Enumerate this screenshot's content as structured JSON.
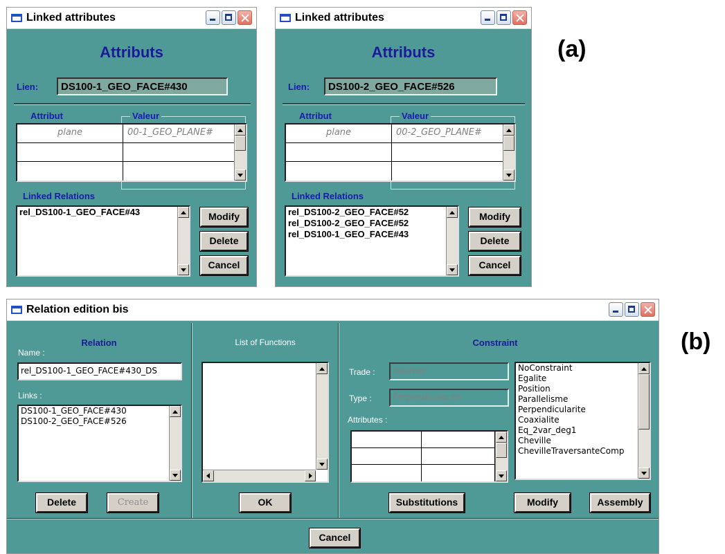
{
  "labels": {
    "a": "(a)",
    "b": "(b)"
  },
  "winA1": {
    "title": "Linked attributes",
    "heading": "Attributs",
    "lien_label": "Lien:",
    "lien_value": "DS100-1_GEO_FACE#430",
    "col_attribut": "Attribut",
    "col_valeur": "Valeur",
    "row_attr": "plane",
    "row_val": "00-1_GEO_PLANE#",
    "linked_label": "Linked Relations",
    "relations": [
      "rel_DS100-1_GEO_FACE#43"
    ],
    "btn_modify": "Modify",
    "btn_delete": "Delete",
    "btn_cancel": "Cancel"
  },
  "winA2": {
    "title": "Linked attributes",
    "heading": "Attributs",
    "lien_label": "Lien:",
    "lien_value": "DS100-2_GEO_FACE#526",
    "col_attribut": "Attribut",
    "col_valeur": "Valeur",
    "row_attr": "plane",
    "row_val": "00-2_GEO_PLANE#",
    "linked_label": "Linked Relations",
    "relations": [
      "rel_DS100-2_GEO_FACE#52",
      "rel_DS100-2_GEO_FACE#52",
      "rel_DS100-1_GEO_FACE#43"
    ],
    "btn_modify": "Modify",
    "btn_delete": "Delete",
    "btn_cancel": "Cancel"
  },
  "winB": {
    "title": "Relation edition bis",
    "relation_heading": "Relation",
    "name_label": "Name :",
    "name_value": "rel_DS100-1_GEO_FACE#430_DS",
    "links_label": "Links :",
    "links": [
      "DS100-1_GEO_FACE#430",
      "DS100-2_GEO_FACE#526"
    ],
    "btn_delete": "Delete",
    "btn_create": "Create",
    "functions_heading": "List of Functions",
    "btn_ok": "OK",
    "constraint_heading": "Constraint",
    "trade_label": "Trade :",
    "trade_value": "Geomet",
    "type_label": "Type :",
    "type_value": "Perpendicularite",
    "attributes_label": "Attributes :",
    "constraints": [
      "NoConstraint",
      "Egalite",
      "Position",
      "Parallelisme",
      "Perpendicularite",
      "Coaxialite",
      "Eq_2var_deg1",
      "Cheville",
      "ChevilleTraversanteComp"
    ],
    "btn_substitutions": "Substitutions",
    "btn_modify": "Modify",
    "btn_assembly": "Assembly",
    "btn_cancel": "Cancel"
  }
}
